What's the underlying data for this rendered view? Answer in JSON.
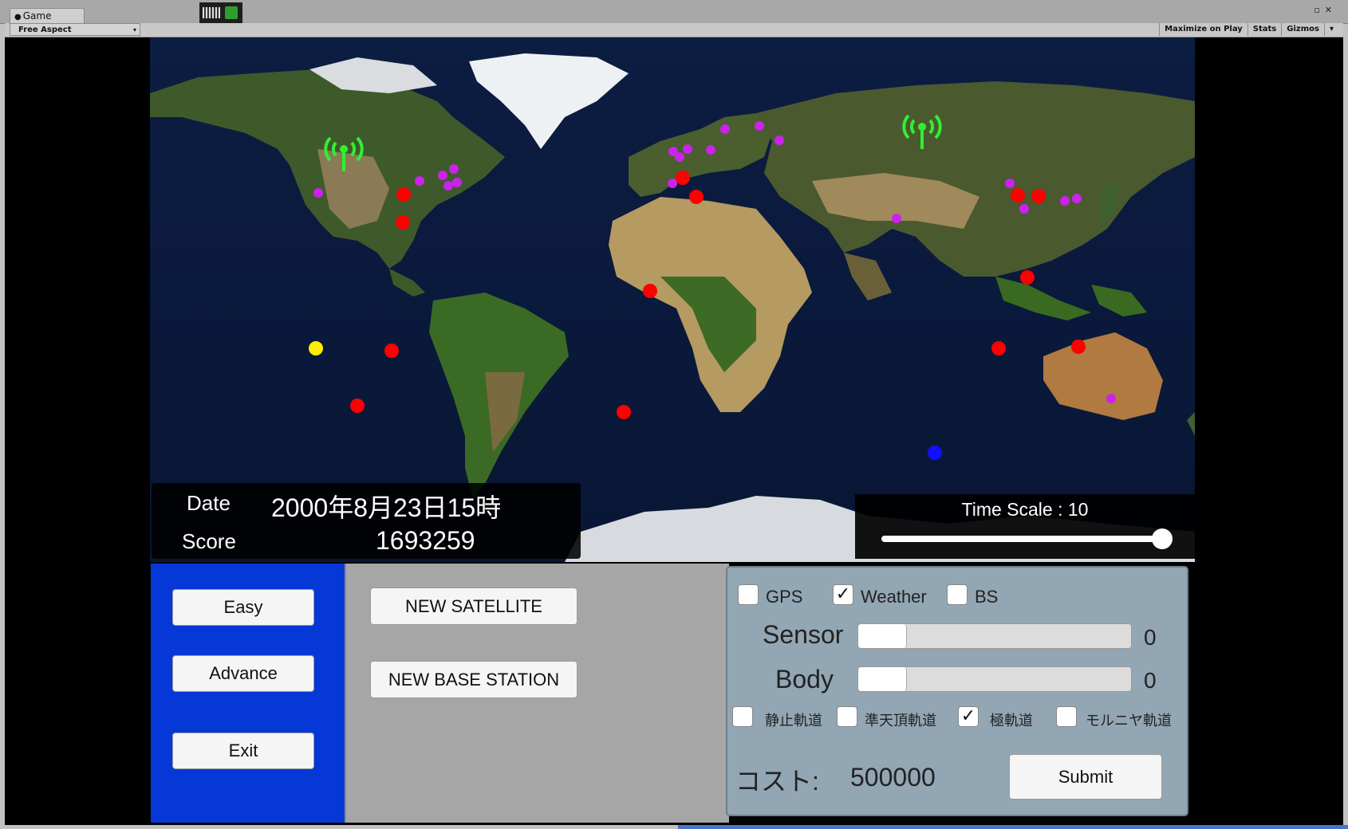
{
  "editor": {
    "tab_label": "Game",
    "aspect_label": "Free Aspect",
    "toolbar_buttons": [
      "Maximize on Play",
      "Stats",
      "Gizmos"
    ]
  },
  "info": {
    "date_label": "Date",
    "date_value": "2000年8月23日15時",
    "score_label": "Score",
    "score_value": "1693259"
  },
  "timescale": {
    "label": "Time Scale : 10",
    "value_fraction": 0.97
  },
  "difficulty": {
    "easy": "Easy",
    "advance": "Advance",
    "exit": "Exit"
  },
  "actions": {
    "new_satellite": "NEW SATELLITE",
    "new_base_station": "NEW BASE STATION"
  },
  "config": {
    "types": [
      {
        "label": "GPS",
        "checked": false
      },
      {
        "label": "Weather",
        "checked": true
      },
      {
        "label": "BS",
        "checked": false
      }
    ],
    "sensor_label": "Sensor",
    "sensor_value": "0",
    "body_label": "Body",
    "body_value": "0",
    "orbits": [
      {
        "label": "静止軌道",
        "checked": false
      },
      {
        "label": "準天頂軌道",
        "checked": false
      },
      {
        "label": "極軌道",
        "checked": true
      },
      {
        "label": "モルニヤ軌道",
        "checked": false
      }
    ],
    "cost_label": "コスト:",
    "cost_value": "500000",
    "submit": "Submit"
  },
  "colors": {
    "demand_marker": "#ff0000",
    "city_marker": "#cc22ee",
    "selected_marker": "#ffee00",
    "satellite_marker": "#1010ff",
    "base_station": "#33ee33",
    "panel_blue": "#0638d8"
  }
}
